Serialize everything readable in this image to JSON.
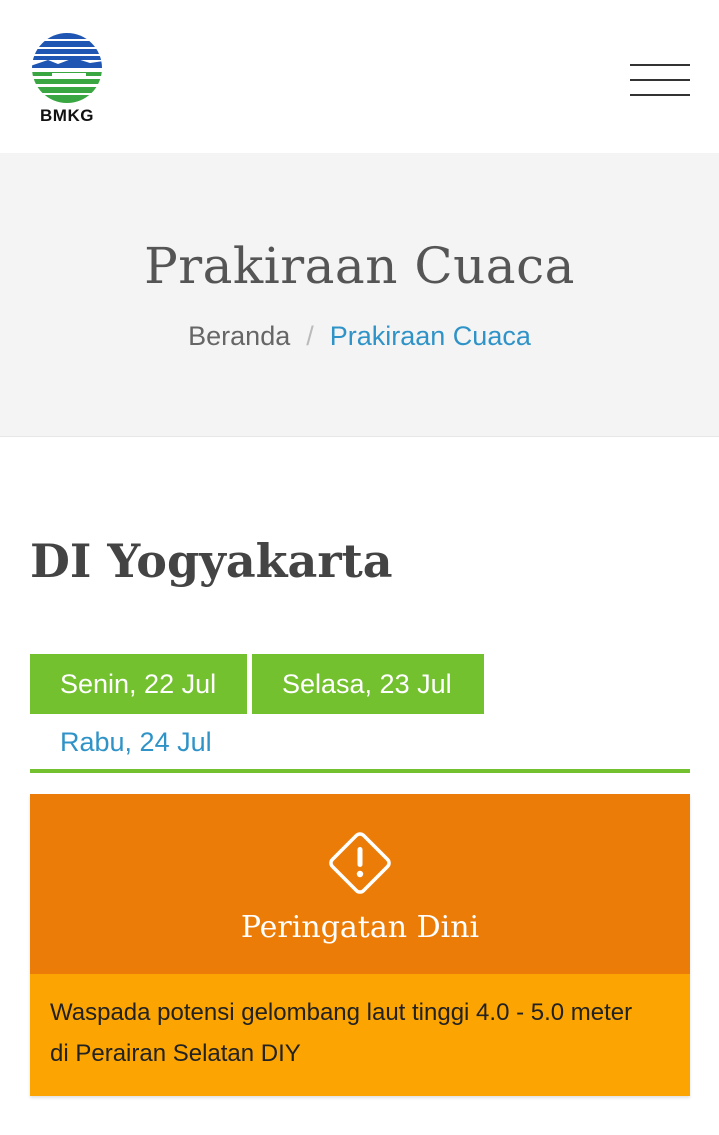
{
  "header": {
    "logo_text": "BMKG",
    "menu_icon": "hamburger-menu-icon"
  },
  "hero": {
    "title": "Prakiraan Cuaca",
    "breadcrumb": {
      "home": "Beranda",
      "separator": "/",
      "current": "Prakiraan Cuaca"
    }
  },
  "region": {
    "title": "DI Yogyakarta"
  },
  "tabs": [
    {
      "label": "Senin, 22 Jul",
      "state": "active"
    },
    {
      "label": "Selasa, 23 Jul",
      "state": "active"
    },
    {
      "label": "Rabu, 24 Jul",
      "state": "link"
    }
  ],
  "warning": {
    "icon": "warning-diamond-icon",
    "title": "Peringatan Dini",
    "text": "Waspada potensi gelombang laut tinggi 4.0 - 5.0 meter di Perairan Selatan DIY"
  },
  "colors": {
    "accent_green": "#74c12f",
    "link_blue": "#2f93c8",
    "warning_orange": "#ec7c08",
    "warning_amber": "#fba402"
  }
}
